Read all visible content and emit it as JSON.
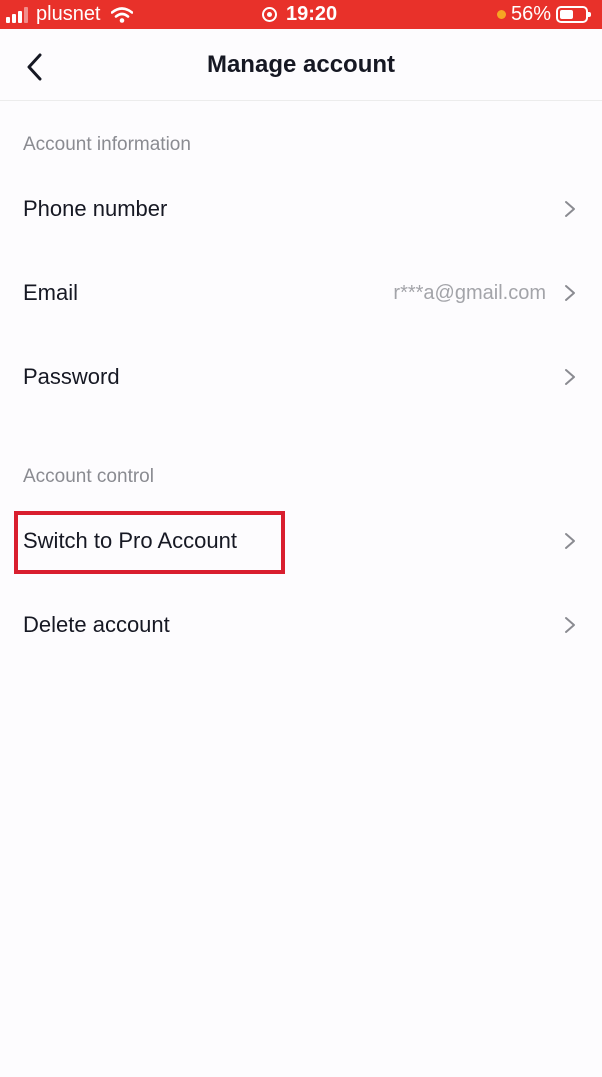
{
  "status_bar": {
    "carrier": "plusnet",
    "time": "19:20",
    "battery_percent": "56%",
    "background_color": "#e8312a"
  },
  "nav": {
    "title": "Manage account",
    "back_icon": "chevron-left-icon"
  },
  "sections": [
    {
      "header": "Account information",
      "items": [
        {
          "label": "Phone number",
          "value": ""
        },
        {
          "label": "Email",
          "value": "r***a@gmail.com"
        },
        {
          "label": "Password",
          "value": ""
        }
      ]
    },
    {
      "header": "Account control",
      "items": [
        {
          "label": "Switch to Pro Account",
          "value": "",
          "highlighted": true
        },
        {
          "label": "Delete account",
          "value": ""
        }
      ]
    }
  ],
  "row_chevron_icon": "chevron-right-icon",
  "highlight_color": "#d91f2f"
}
